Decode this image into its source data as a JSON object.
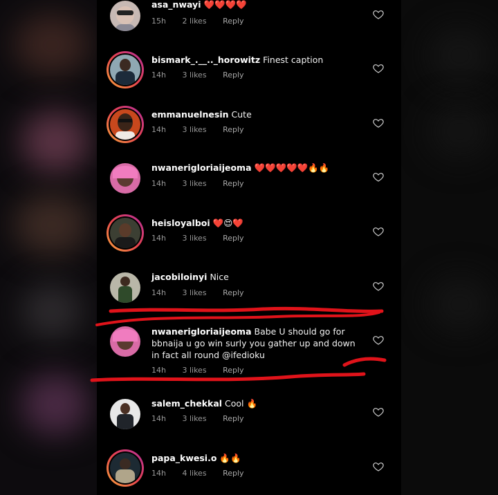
{
  "comments": [
    {
      "username": "asa_nwayi",
      "text": "❤️❤️❤️❤️",
      "time": "15h",
      "likes": "2 likes",
      "reply": "Reply"
    },
    {
      "username": "bismark_.__.._horowitz",
      "text": "Finest caption",
      "time": "14h",
      "likes": "3 likes",
      "reply": "Reply"
    },
    {
      "username": "emmanuelnesin",
      "text": "Cute",
      "time": "14h",
      "likes": "3 likes",
      "reply": "Reply"
    },
    {
      "username": "nwanerigloriaijeoma",
      "text": "❤️❤️❤️❤️❤️🔥🔥",
      "time": "14h",
      "likes": "3 likes",
      "reply": "Reply"
    },
    {
      "username": "heisloyalboi",
      "text": "❤️😍❤️",
      "time": "14h",
      "likes": "3 likes",
      "reply": "Reply"
    },
    {
      "username": "jacobiloinyi",
      "text": "Nice",
      "time": "14h",
      "likes": "3 likes",
      "reply": "Reply"
    },
    {
      "username": "nwanerigloriaijeoma",
      "text": "Babe U should go for bbnaija  u go win surly you gather up and down in fact all round @ifedioku",
      "time": "14h",
      "likes": "3 likes",
      "reply": "Reply"
    },
    {
      "username": "salem_chekkal",
      "text": "Cool 🔥",
      "time": "14h",
      "likes": "3 likes",
      "reply": "Reply"
    },
    {
      "username": "papa_kwesi.o",
      "text": "🔥🔥",
      "time": "14h",
      "likes": "4 likes",
      "reply": "Reply"
    }
  ],
  "colors": {
    "background": "#000000",
    "text": "#f2f2f2",
    "meta": "#9a9a9a",
    "annotation": "#e0131a"
  },
  "icons": {
    "like": "heart-outline-icon"
  }
}
